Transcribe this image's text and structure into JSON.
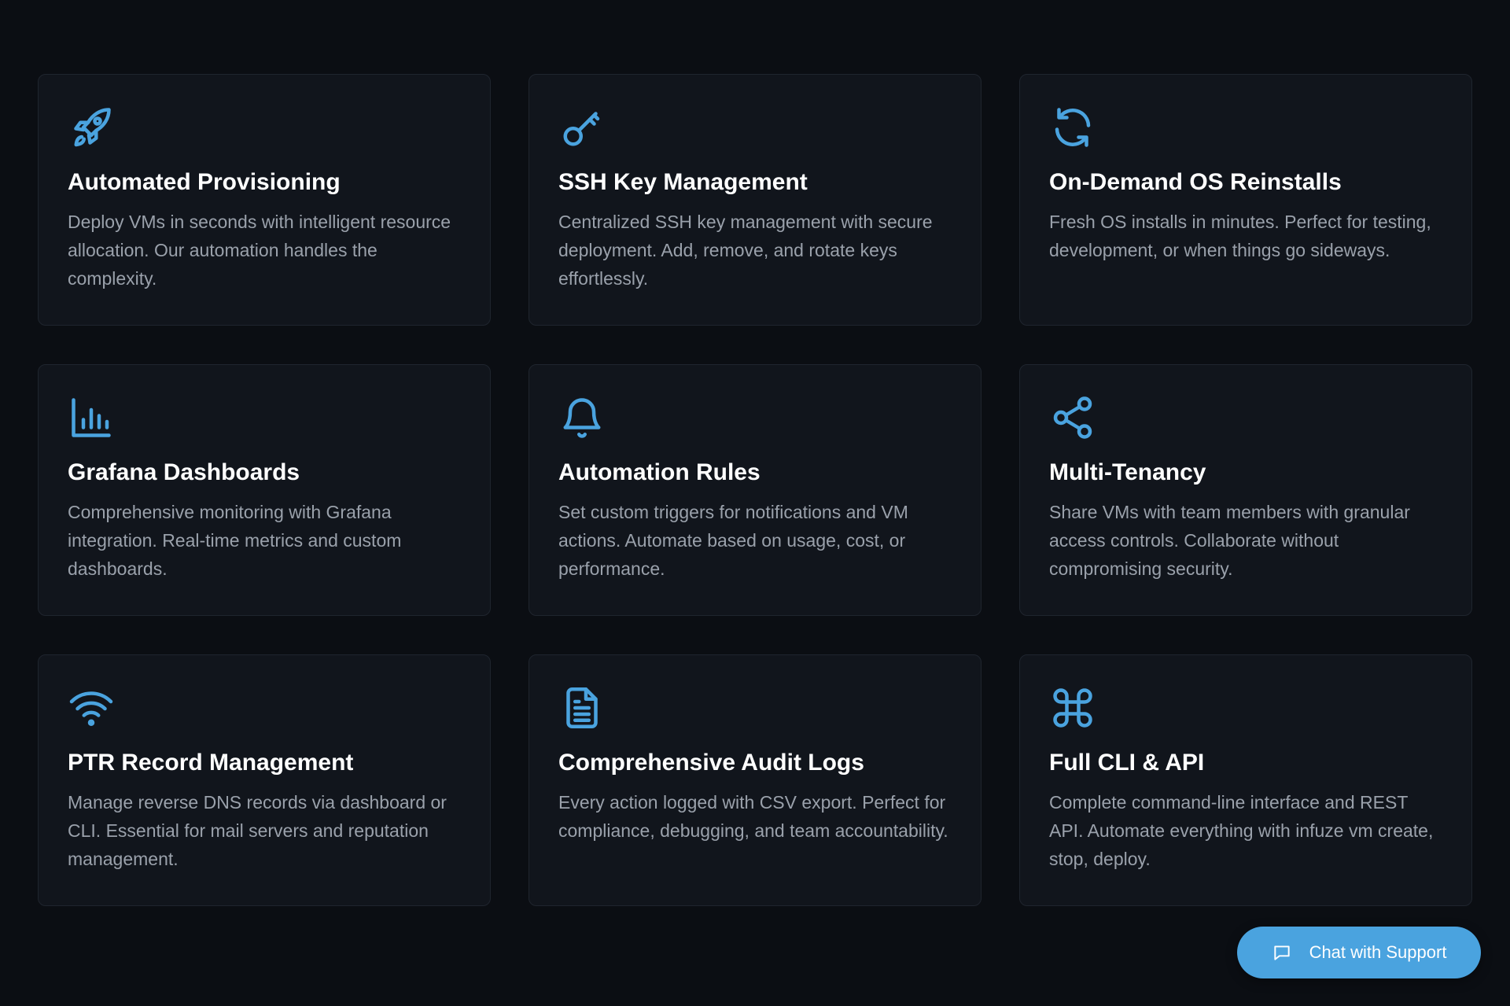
{
  "features": [
    {
      "icon": "rocket-icon",
      "title": "Automated Provisioning",
      "description": "Deploy VMs in seconds with intelligent resource allocation. Our automation handles the complexity."
    },
    {
      "icon": "key-icon",
      "title": "SSH Key Management",
      "description": "Centralized SSH key management with secure deployment. Add, remove, and rotate keys effortlessly."
    },
    {
      "icon": "refresh-icon",
      "title": "On-Demand OS Reinstalls",
      "description": "Fresh OS installs in minutes. Perfect for testing, development, or when things go sideways."
    },
    {
      "icon": "bar-chart-icon",
      "title": "Grafana Dashboards",
      "description": "Comprehensive monitoring with Grafana integration. Real-time metrics and custom dashboards."
    },
    {
      "icon": "bell-icon",
      "title": "Automation Rules",
      "description": "Set custom triggers for notifications and VM actions. Automate based on usage, cost, or performance."
    },
    {
      "icon": "share-icon",
      "title": "Multi-Tenancy",
      "description": "Share VMs with team members with granular access controls. Collaborate without compromising security."
    },
    {
      "icon": "wifi-icon",
      "title": "PTR Record Management",
      "description": "Manage reverse DNS records via dashboard or CLI. Essential for mail servers and reputation management."
    },
    {
      "icon": "document-icon",
      "title": "Comprehensive Audit Logs",
      "description": "Every action logged with CSV export. Perfect for compliance, debugging, and team accountability."
    },
    {
      "icon": "command-icon",
      "title": "Full CLI & API",
      "description": "Complete command-line interface and REST API. Automate everything with infuze vm create, stop, deploy."
    }
  ],
  "chat": {
    "label": "Chat with Support",
    "icon": "chat-bubble-icon"
  },
  "colors": {
    "background": "#0b0e13",
    "card": "#11151c",
    "accent": "#4aa3df",
    "title": "#ffffff",
    "text": "#9aa1ab"
  }
}
